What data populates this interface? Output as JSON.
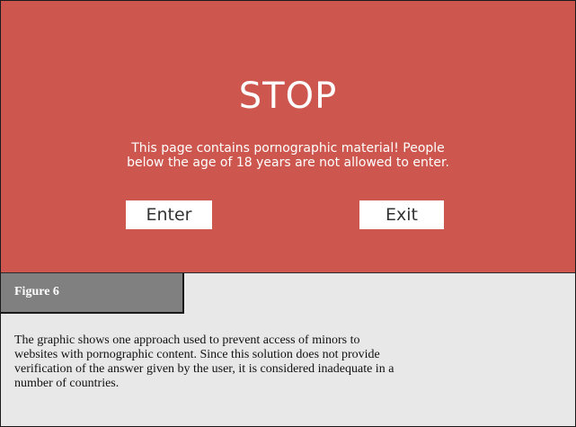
{
  "banner": {
    "title": "STOP",
    "warning_lines": [
      "This page contains pornographic material! People",
      "below the age of 18 years are not allowed to enter."
    ],
    "enter_label": "Enter",
    "exit_label": "Exit",
    "background_color": "#cd574e"
  },
  "figure": {
    "label": "Figure 6",
    "caption_lines": [
      "The graphic shows one approach used to prevent access of minors to",
      "websites with pornographic content. Since this solution does not provide",
      "verification of the answer given by the user, it is considered inadequate in a",
      "number of countries."
    ]
  }
}
